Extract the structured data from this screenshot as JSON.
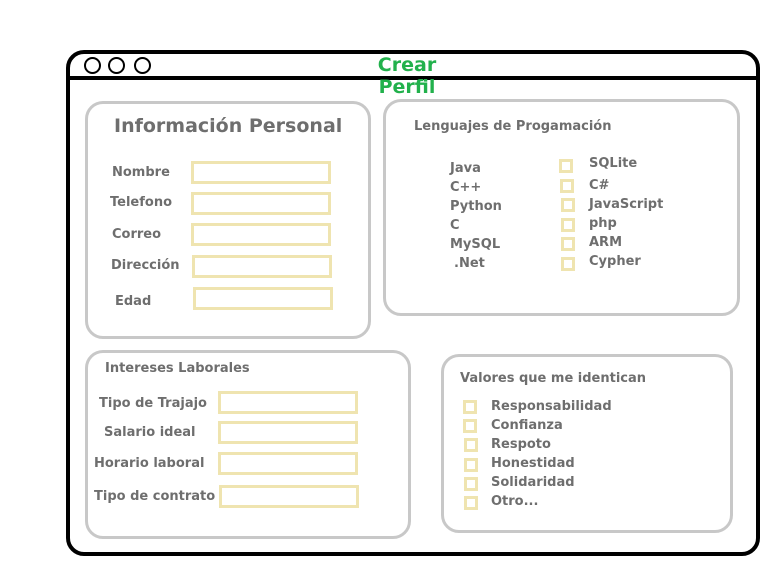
{
  "window": {
    "title": "Crear Perfil"
  },
  "personal": {
    "heading": "Información Personal",
    "fields": [
      "Nombre",
      "Telefono",
      "Correo",
      "Dirección",
      "Edad"
    ]
  },
  "languages": {
    "heading": "Lenguajes de Progamación",
    "left": [
      "Java",
      "C++",
      "Python",
      "C",
      "MySQL",
      ".Net"
    ],
    "right": [
      "SQLite",
      "C#",
      "JavaScript",
      "php",
      "ARM",
      "Cypher"
    ]
  },
  "work": {
    "heading": "Intereses Laborales",
    "fields": [
      "Tipo de Trajajo",
      "Salario ideal",
      "Horario laboral",
      "Tipo de contrato"
    ]
  },
  "values": {
    "heading": "Valores que me identican",
    "items": [
      "Responsabilidad",
      "Confianza",
      "Respoto",
      "Honestidad",
      "Solidaridad",
      "Otro..."
    ]
  }
}
